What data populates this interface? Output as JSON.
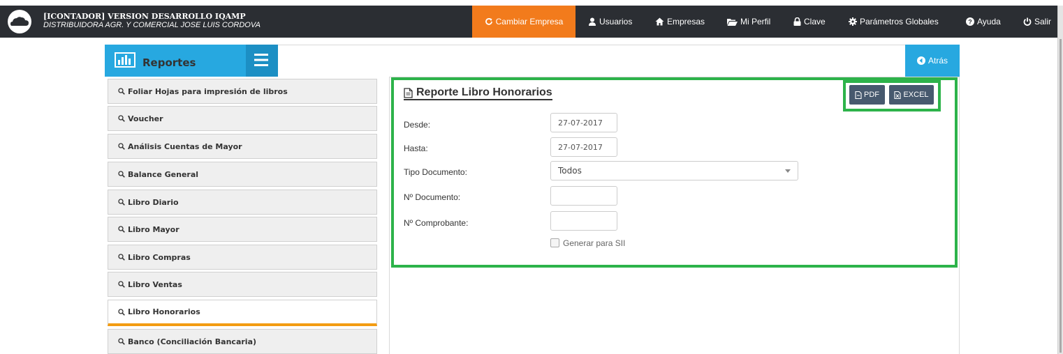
{
  "header": {
    "title_line1": "[ICONTADOR] VERSION DESARROLLO IQAMP",
    "title_line2": "DISTRIBUIDORA AGR. Y COMERCIAL JOSE LUIS CORDOVA",
    "nav": {
      "cambiar_empresa": "Cambiar Empresa",
      "usuarios": "Usuarios",
      "empresas": "Empresas",
      "mi_perfil": "Mi Perfil",
      "clave": "Clave",
      "parametros_globales": "Parámetros Globales",
      "ayuda": "Ayuda",
      "salir": "Salir"
    },
    "active_color": "#f27b1c"
  },
  "panel": {
    "title": "Reportes",
    "back": "Atrás"
  },
  "sidebar": {
    "items": [
      {
        "label": "Foliar Hojas para impresión de libros"
      },
      {
        "label": "Voucher"
      },
      {
        "label": "Análisis Cuentas de Mayor"
      },
      {
        "label": "Balance General"
      },
      {
        "label": "Libro Diario"
      },
      {
        "label": "Libro Mayor"
      },
      {
        "label": "Libro Compras"
      },
      {
        "label": "Libro Ventas"
      },
      {
        "label": "Libro Honorarios",
        "active": true
      },
      {
        "label": "Banco (Conciliación Bancaria)"
      }
    ]
  },
  "report": {
    "title": "Reporte Libro Honorarios",
    "pdf": "PDF",
    "excel": "EXCEL",
    "fields": {
      "desde_label": "Desde:",
      "desde_value": "27-07-2017",
      "hasta_label": "Hasta:",
      "hasta_value": "27-07-2017",
      "tipo_label": "Tipo Documento:",
      "tipo_value": "Todos",
      "ndoc_label": "Nº Documento:",
      "ndoc_value": "",
      "ncomp_label": "Nº Comprobante:",
      "ncomp_value": "",
      "sii_label": "Generar para SII"
    }
  },
  "colors": {
    "accent_blue": "#27a8e0",
    "highlight_green": "#2db34a",
    "active_underline": "#f39c12",
    "topbar": "#2b2e33"
  }
}
